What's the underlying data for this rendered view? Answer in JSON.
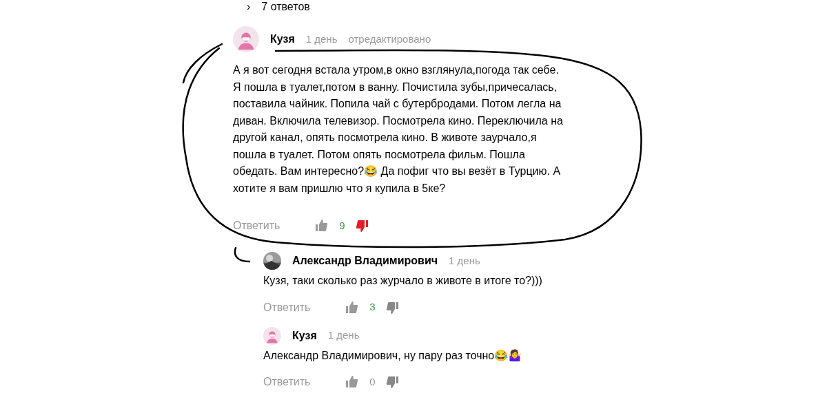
{
  "replies_toggle": {
    "icon": "›",
    "label": "7 ответов"
  },
  "comment": {
    "author": "Кузя",
    "kind": "figure",
    "time": "1 день",
    "edited": "отредактировано",
    "text": "А я вот сегодня встала утром,в окно взглянула,погода так себе. Я пошла в туалет,потом в ванну. Почистила зубы,причесалась, поставила чайник. Попила чай с бутербродами. Потом легла на диван. Включила телевизор. Посмотрела кино. Переключила на другой канал, опять посмотрела кино. В животе заурчало,я пошла в туалет. Потом опять посмотрела фильм. Пошла обедать. Вам интересно?😂 Да пофиг что вы везёт в Турцию. А хотите я вам пришлю что я купила в 5ке?",
    "reply": "Ответить",
    "score": "9",
    "score_positive": true,
    "disliked": true,
    "children": [
      {
        "author": "Александр Владимирович",
        "time": "1 день",
        "text": "Кузя, таки сколько раз журчало в животе в итоге то?)))",
        "reply": "Ответить",
        "score": "3",
        "score_positive": true,
        "disliked": false
      },
      {
        "author": "Кузя",
        "kind": "figure",
        "time": "1 день",
        "text": "Александр Владимирович, ну пару раз точно😂🤷‍♀️",
        "reply": "Ответить",
        "score": "0",
        "score_positive": false,
        "disliked": false
      }
    ]
  }
}
